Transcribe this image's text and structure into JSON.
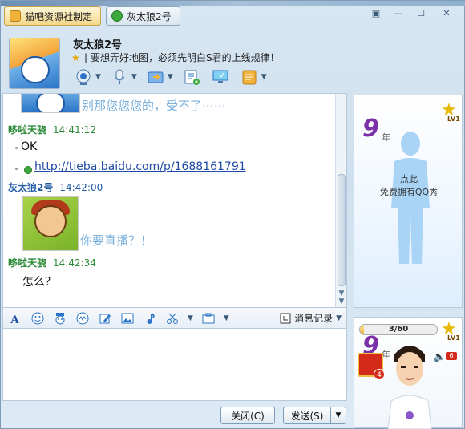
{
  "tabs": [
    {
      "label": "猫吧资源社制定",
      "active": true
    },
    {
      "label": "灰太狼2号",
      "active": false
    }
  ],
  "window_controls": [
    "restore",
    "minimize",
    "maximize",
    "close"
  ],
  "contact": {
    "nickname": "灰太狼2号",
    "signature": "要想弄好地图，必须先明白S君的上线规律！"
  },
  "top_toolbar": [
    "video-camera",
    "voice-microphone",
    "file-transfer",
    "application-list",
    "remote-desktop",
    "more-apps"
  ],
  "messages": [
    {
      "sender": "哆啦天骁",
      "time": "14:41:12",
      "lines": [
        "OK"
      ]
    },
    {
      "sender": "灰太狼2号",
      "time": "14:42:00",
      "text": "你要直播？！"
    },
    {
      "sender": "哆啦天骁",
      "time": "14:42:34",
      "lines": [
        "怎么？"
      ]
    }
  ],
  "preview_text": "别那您您您的，受不了⋯⋯",
  "link_text": "http://tieba.baidu.com/p/1688161791",
  "format_toolbar": [
    "font",
    "emoticon",
    "magic-face",
    "shake",
    "handwriting",
    "image",
    "music",
    "screenshot",
    "more"
  ],
  "history_label": "消息记录",
  "buttons": {
    "close": "关闭(C)",
    "send": "发送(S)"
  },
  "show_panel": {
    "badge_number": "9",
    "badge_unit": "年",
    "level": "LV1",
    "line1": "点此",
    "line2": "免费拥有QQ秀"
  },
  "avatar_panel": {
    "progress_text": "3/60",
    "progress_value": 0.05,
    "badge_number": "9",
    "badge_unit": "年",
    "level": "LV1",
    "gift_count": "4",
    "notify_count": "6"
  },
  "colors": {
    "green_sender": "#2e8b3a",
    "blue_sender": "#1f5aa5",
    "link": "#1f4aa5",
    "preview_text": "#7cb1de"
  }
}
